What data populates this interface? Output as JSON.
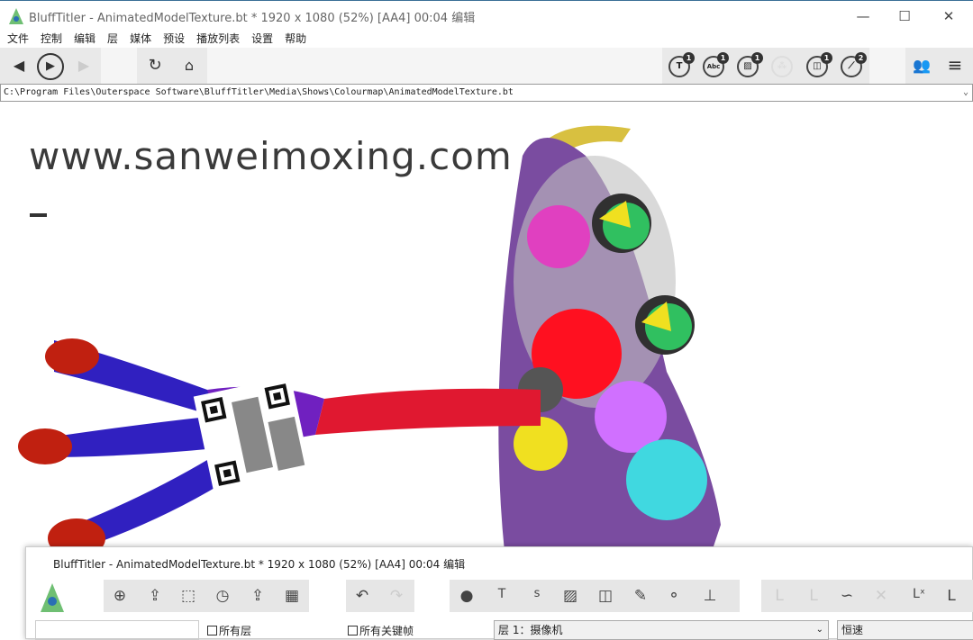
{
  "window": {
    "title": "BluffTitler - AnimatedModelTexture.bt * 1920 x 1080 (52%) [AA4] 00:04 编辑",
    "controls": [
      "—",
      "☐",
      "✕"
    ]
  },
  "menu": [
    "文件",
    "控制",
    "编辑",
    "层",
    "媒体",
    "预设",
    "播放列表",
    "设置",
    "帮助"
  ],
  "toolbar": {
    "badges": [
      {
        "icon": "text-layer",
        "label": "T",
        "count": "1"
      },
      {
        "icon": "abc-layer",
        "label": "Abc",
        "count": "1"
      },
      {
        "icon": "picture-layer",
        "label": "▨",
        "count": "1"
      },
      {
        "icon": "particle-layer",
        "label": "⁂",
        "count": ""
      },
      {
        "icon": "model-layer",
        "label": "◫",
        "count": "1"
      },
      {
        "icon": "pencil-layer",
        "label": "⟋",
        "count": "2"
      }
    ]
  },
  "path": "C:\\Program Files\\Outerspace Software\\BluffTitler\\Media\\Shows\\Colourmap\\AnimatedModelTexture.bt",
  "canvas": {
    "watermark": "www.sanweimoxing.com"
  },
  "editor": {
    "title": "BluffTitler - AnimatedModelTexture.bt * 1920 x 1080 (52%) [AA4] 00:04 编辑",
    "all_layers": "所有层",
    "all_keyframes": "所有关键帧",
    "layer_select": "层 1：摄像机",
    "speed_select": "恒速"
  }
}
